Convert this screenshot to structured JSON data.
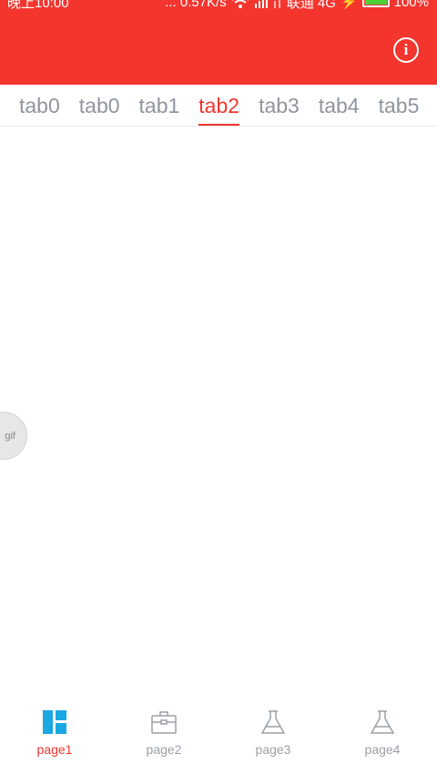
{
  "status_bar": {
    "time": "晚上10:00",
    "network_speed": "... 0.57K/s",
    "carrier": "联通 4G",
    "battery": "100%"
  },
  "colors": {
    "accent": "#f3352e",
    "active_nav_icon": "#1aa8e3",
    "inactive": "#9aa0a6"
  },
  "appbar": {
    "info_icon": "info-icon",
    "info_glyph": "i"
  },
  "tabs": [
    {
      "label": "tab0",
      "active": false
    },
    {
      "label": "tab0",
      "active": false
    },
    {
      "label": "tab1",
      "active": false
    },
    {
      "label": "tab2",
      "active": true
    },
    {
      "label": "tab3",
      "active": false
    },
    {
      "label": "tab4",
      "active": false
    },
    {
      "label": "tab5",
      "active": false
    }
  ],
  "floating": {
    "label": "gif"
  },
  "bottom_nav": [
    {
      "label": "page1",
      "icon": "dashboard-icon",
      "active": true
    },
    {
      "label": "page2",
      "icon": "briefcase-icon",
      "active": false
    },
    {
      "label": "page3",
      "icon": "flask-icon",
      "active": false
    },
    {
      "label": "page4",
      "icon": "flask-icon",
      "active": false
    }
  ]
}
